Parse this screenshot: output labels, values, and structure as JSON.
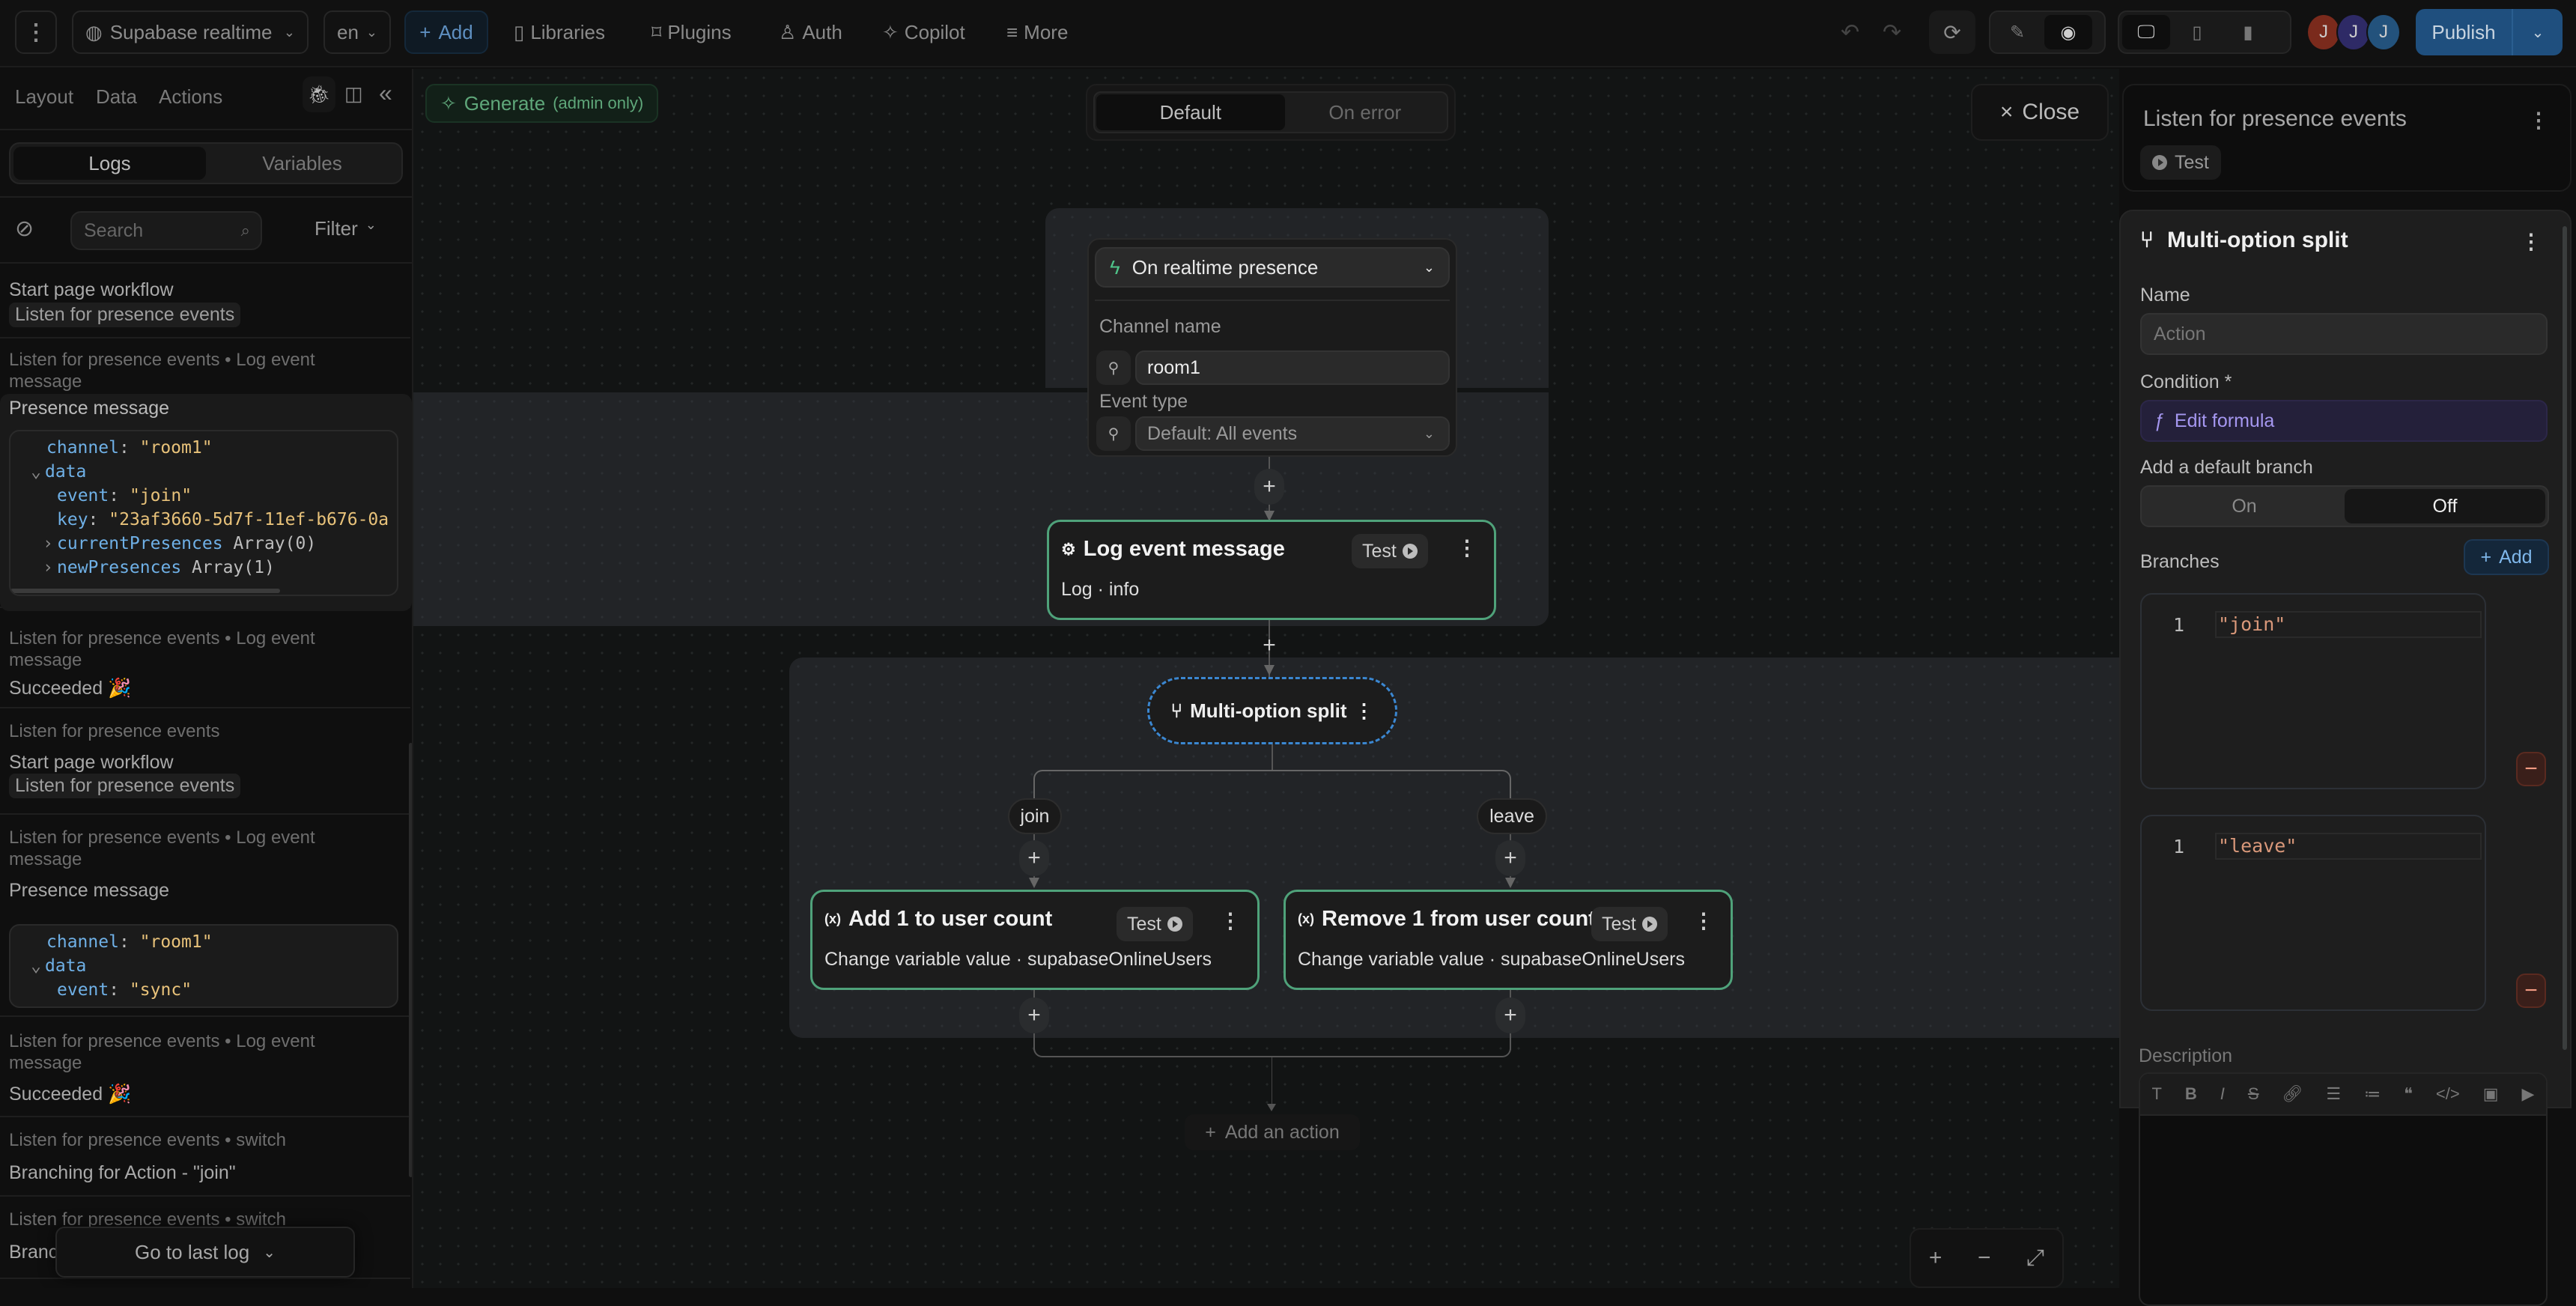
{
  "topbar": {
    "menu_icon": "kebab-vertical-icon",
    "project": "Supabase realtime",
    "language": "en",
    "add": "Add",
    "links": [
      {
        "label": "Libraries",
        "icon": "book-icon"
      },
      {
        "label": "Plugins",
        "icon": "puzzle-icon"
      },
      {
        "label": "Auth",
        "icon": "user-icon"
      },
      {
        "label": "Copilot",
        "icon": "sparkle-icon"
      },
      {
        "label": "More",
        "icon": "menu-icon"
      }
    ],
    "avatars": [
      {
        "initial": "J",
        "color": "#7a2a1c"
      },
      {
        "initial": "J",
        "color": "#2e2a66"
      },
      {
        "initial": "J",
        "color": "#23527c"
      }
    ],
    "publish": "Publish",
    "brand_color": "#1f4f7e"
  },
  "left": {
    "tabs": [
      "Layout",
      "Data",
      "Actions"
    ],
    "segment": [
      "Logs",
      "Variables"
    ],
    "search_placeholder": "Search",
    "filter": "Filter",
    "go_to_last": "Go to last log",
    "logs": [
      {
        "main": "Start page workflow",
        "chip": "Listen for presence events"
      },
      {
        "sub": "Listen for presence events • Log event message",
        "main": "Presence message",
        "code": [
          {
            "indent": 1,
            "key": "channel",
            "value": "\"room1\""
          },
          {
            "indent": 0,
            "caret": "⌄",
            "key": "data"
          },
          {
            "indent": 2,
            "key": "event",
            "value": "\"join\""
          },
          {
            "indent": 2,
            "key": "key",
            "value": "\"23af3660-5d7f-11ef-b676-0a"
          },
          {
            "indent": 1,
            "caret": "›",
            "key": "currentPresences",
            "type": "Array(0)"
          },
          {
            "indent": 1,
            "caret": "›",
            "key": "newPresences",
            "type": "Array(1)"
          }
        ]
      },
      {
        "sub": "Listen for presence events • Log event message",
        "main": "Succeeded 🎉"
      },
      {
        "sub": "Listen for presence events",
        "main": "Start page workflow",
        "chip": "Listen for presence events"
      },
      {
        "sub": "Listen for presence events • Log event message",
        "main": "Presence message",
        "code": [
          {
            "indent": 1,
            "key": "channel",
            "value": "\"room1\""
          },
          {
            "indent": 0,
            "caret": "⌄",
            "key": "data"
          },
          {
            "indent": 2,
            "key": "event",
            "value": "\"sync\""
          }
        ]
      },
      {
        "sub": "Listen for presence events • Log event message",
        "main": "Succeeded 🎉"
      },
      {
        "sub": "Listen for presence events • switch",
        "main": "Branching for Action - \"join\""
      },
      {
        "sub": "Listen for presence events • switch",
        "main": "Branching for Action - \"leave\""
      }
    ]
  },
  "canvas": {
    "generate": "Generate",
    "generate_note": "(admin only)",
    "tabs": [
      "Default",
      "On error"
    ],
    "close": "Close",
    "trigger": {
      "title": "On realtime presence",
      "channel_label": "Channel name",
      "channel_value": "room1",
      "event_label": "Event type",
      "event_value": "Default: All events"
    },
    "log_node": {
      "title": "Log event message",
      "sub": "Log · info",
      "test": "Test"
    },
    "split_node": {
      "title": "Multi-option split"
    },
    "branches": [
      "join",
      "leave"
    ],
    "branch_nodes": [
      {
        "title": "Add 1 to user count",
        "sub": "Change variable value · supabaseOnlineUsers",
        "test": "Test"
      },
      {
        "title": "Remove 1 from user count",
        "sub": "Change variable value · supabaseOnlineUsers",
        "test": "Test"
      }
    ],
    "add_action": "Add an action",
    "node_border_color": "#4fa27a"
  },
  "right": {
    "workflow_title": "Listen for presence events",
    "test": "Test",
    "panel_title": "Multi-option split",
    "name_label": "Name",
    "name_placeholder": "Action",
    "condition_label": "Condition",
    "condition_required": "*",
    "edit_formula": "Edit formula",
    "default_branch_label": "Add a default branch",
    "default_branch_options": [
      "On",
      "Off"
    ],
    "default_branch_selected": "Off",
    "branches_label": "Branches",
    "add_branch": "Add",
    "branch_values": [
      {
        "line": "1",
        "code": "\"join\""
      },
      {
        "line": "1",
        "code": "\"leave\""
      }
    ],
    "description_label": "Description",
    "toolbar": [
      "text-icon",
      "bold-icon",
      "italic-icon",
      "strikethrough-icon",
      "link-icon",
      "bullet-list-icon",
      "numbered-list-icon",
      "quote-icon",
      "code-icon",
      "image-icon",
      "video-icon"
    ]
  }
}
